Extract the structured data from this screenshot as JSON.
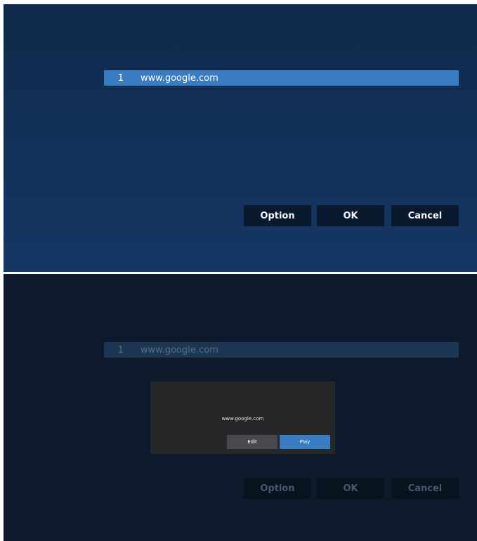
{
  "top_screen": {
    "list": [
      {
        "index": "1",
        "url": "www.google.com"
      }
    ],
    "buttons": {
      "option": "Option",
      "ok": "OK",
      "cancel": "Cancel"
    }
  },
  "bottom_screen": {
    "list": [
      {
        "index": "1",
        "url": "www.google.com"
      }
    ],
    "dialog": {
      "url": "www.google.com",
      "edit_label": "Edit",
      "play_label": "Play"
    },
    "buttons": {
      "option": "Option",
      "ok": "OK",
      "cancel": "Cancel"
    }
  },
  "colors": {
    "selected_row": "#3a7cc2",
    "primary_button": "#3a7cc2",
    "screen_background": "#143764",
    "dim_background": "#0d1a2b"
  }
}
